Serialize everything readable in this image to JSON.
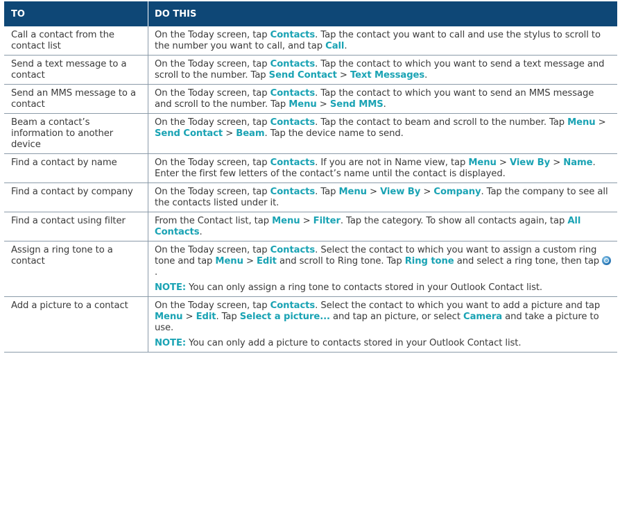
{
  "header": {
    "col1": "TO",
    "col2": "DO THIS"
  },
  "rows": [
    {
      "to": "Call a contact from the contact list",
      "desc": [
        [
          [
            "On the Today screen, tap ",
            0
          ],
          [
            "Contacts",
            1
          ],
          [
            ". Tap the contact you want to call and use the stylus to scroll to the number you want to call, and tap ",
            0
          ],
          [
            "Call",
            1
          ],
          [
            ".",
            0
          ]
        ]
      ]
    },
    {
      "to": "Send a text message to a contact",
      "desc": [
        [
          [
            "On the Today screen, tap ",
            0
          ],
          [
            "Contacts",
            1
          ],
          [
            ". Tap the contact to which you want to send a text message and scroll to the number. Tap ",
            0
          ],
          [
            "Send Contact",
            1
          ],
          [
            " > ",
            0
          ],
          [
            "Text Messages",
            1
          ],
          [
            ".",
            0
          ]
        ]
      ]
    },
    {
      "to": "Send an MMS message to a contact",
      "desc": [
        [
          [
            "On the Today screen, tap ",
            0
          ],
          [
            "Contacts",
            1
          ],
          [
            ". Tap the contact to which you want to send an MMS message and scroll to the number. Tap ",
            0
          ],
          [
            "Menu",
            1
          ],
          [
            " > ",
            0
          ],
          [
            "Send MMS",
            1
          ],
          [
            ".",
            0
          ]
        ]
      ]
    },
    {
      "to": "Beam a contact’s information to another device",
      "desc": [
        [
          [
            "On the Today screen, tap ",
            0
          ],
          [
            "Contacts",
            1
          ],
          [
            ". Tap the contact to beam and scroll to the number. Tap ",
            0
          ],
          [
            "Menu",
            1
          ],
          [
            " > ",
            0
          ],
          [
            "Send Contact",
            1
          ],
          [
            " > ",
            0
          ],
          [
            "Beam",
            1
          ],
          [
            ". Tap the device name to send.",
            0
          ]
        ]
      ]
    },
    {
      "to": "Find a contact by name",
      "desc": [
        [
          [
            "On the Today screen, tap ",
            0
          ],
          [
            "Contacts",
            1
          ],
          [
            ". If you are not in Name view, tap ",
            0
          ],
          [
            "Menu",
            1
          ],
          [
            " > ",
            0
          ],
          [
            "View By",
            1
          ],
          [
            " > ",
            0
          ],
          [
            "Name",
            1
          ],
          [
            ". Enter the first few letters of the contact’s name until the contact is displayed.",
            0
          ]
        ]
      ]
    },
    {
      "to": "Find a contact by company",
      "desc": [
        [
          [
            "On the Today screen, tap ",
            0
          ],
          [
            "Contacts",
            1
          ],
          [
            ". Tap ",
            0
          ],
          [
            "Menu",
            1
          ],
          [
            " > ",
            0
          ],
          [
            "View By",
            1
          ],
          [
            " > ",
            0
          ],
          [
            "Company",
            1
          ],
          [
            ". Tap the company to see all the contacts listed under it.",
            0
          ]
        ]
      ]
    },
    {
      "to": "Find a contact using filter",
      "desc": [
        [
          [
            "From the Contact list, tap ",
            0
          ],
          [
            "Menu",
            1
          ],
          [
            " > ",
            0
          ],
          [
            "Filter",
            1
          ],
          [
            ". Tap the category. To show all contacts again, tap ",
            0
          ],
          [
            "All Contacts",
            1
          ],
          [
            ".",
            0
          ]
        ]
      ]
    },
    {
      "to": "Assign a ring tone to a contact",
      "desc": [
        [
          [
            "On the Today screen, tap ",
            0
          ],
          [
            "Contacts",
            1
          ],
          [
            ". Select the contact to which you want to assign a custom ring tone and tap ",
            0
          ],
          [
            "Menu",
            1
          ],
          [
            " > ",
            0
          ],
          [
            "Edit",
            1
          ],
          [
            " and scroll to Ring tone. Tap ",
            0
          ],
          [
            "Ring tone",
            1
          ],
          [
            " and select a ring tone, then tap ",
            0
          ],
          [
            "ok-icon",
            2
          ],
          [
            ".",
            0
          ]
        ],
        [
          [
            "NOTE:",
            1
          ],
          [
            " You can only assign a ring tone to contacts stored in your Outlook Contact list.",
            0
          ]
        ]
      ]
    },
    {
      "to": "Add a picture to a contact",
      "desc": [
        [
          [
            "On the Today screen, tap ",
            0
          ],
          [
            "Contacts",
            1
          ],
          [
            ". Select the contact to which you want to add a picture and tap ",
            0
          ],
          [
            "Menu",
            1
          ],
          [
            " > ",
            0
          ],
          [
            "Edit",
            1
          ],
          [
            ". Tap ",
            0
          ],
          [
            "Select a picture...",
            1
          ],
          [
            " and tap an picture, or select ",
            0
          ],
          [
            "Camera",
            1
          ],
          [
            " and take a picture to use.",
            0
          ]
        ],
        [
          [
            "NOTE:",
            1
          ],
          [
            " You can only add a picture to contacts stored in your Outlook Contact list.",
            0
          ]
        ]
      ]
    }
  ]
}
